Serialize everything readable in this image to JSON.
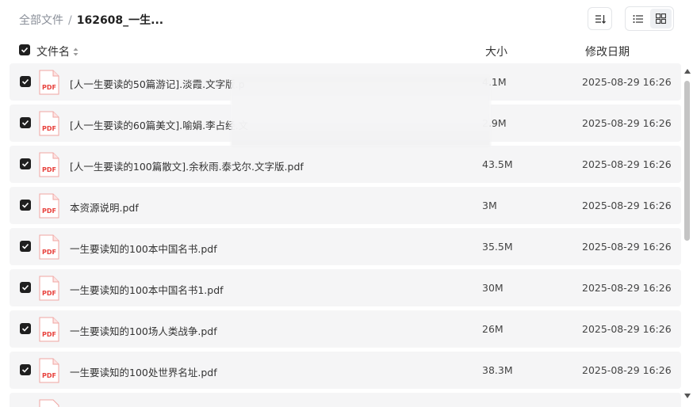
{
  "breadcrumb": {
    "root": "全部文件",
    "separator": "/",
    "current": "162608_一生..."
  },
  "columns": {
    "name": "文件名",
    "size": "大小",
    "modified": "修改日期"
  },
  "file_icon_label": "PDF",
  "files": [
    {
      "name": "[人一生要读的50篇游记].淡霞.文字版.p",
      "size": "4.1M",
      "modified": "2025-08-29 16:26"
    },
    {
      "name": "[人一生要读的60篇美文].喻娟.李占经.文",
      "size": "2.9M",
      "modified": "2025-08-29 16:26"
    },
    {
      "name": "[人一生要读的100篇散文].余秋雨.泰戈尔.文字版.pdf",
      "size": "43.5M",
      "modified": "2025-08-29 16:26"
    },
    {
      "name": "本资源说明.pdf",
      "size": "3M",
      "modified": "2025-08-29 16:26"
    },
    {
      "name": "一生要读知的100本中国名书.pdf",
      "size": "35.5M",
      "modified": "2025-08-29 16:26"
    },
    {
      "name": "一生要读知的100本中国名书1.pdf",
      "size": "30M",
      "modified": "2025-08-29 16:26"
    },
    {
      "name": "一生要读知的100场人类战争.pdf",
      "size": "26M",
      "modified": "2025-08-29 16:26"
    },
    {
      "name": "一生要读知的100处世界名址.pdf",
      "size": "38.3M",
      "modified": "2025-08-29 16:26"
    }
  ],
  "colors": {
    "checkbox": "#1f1f1f",
    "pdf_red": "#e8413c",
    "row_bg": "#f5f5f6"
  }
}
